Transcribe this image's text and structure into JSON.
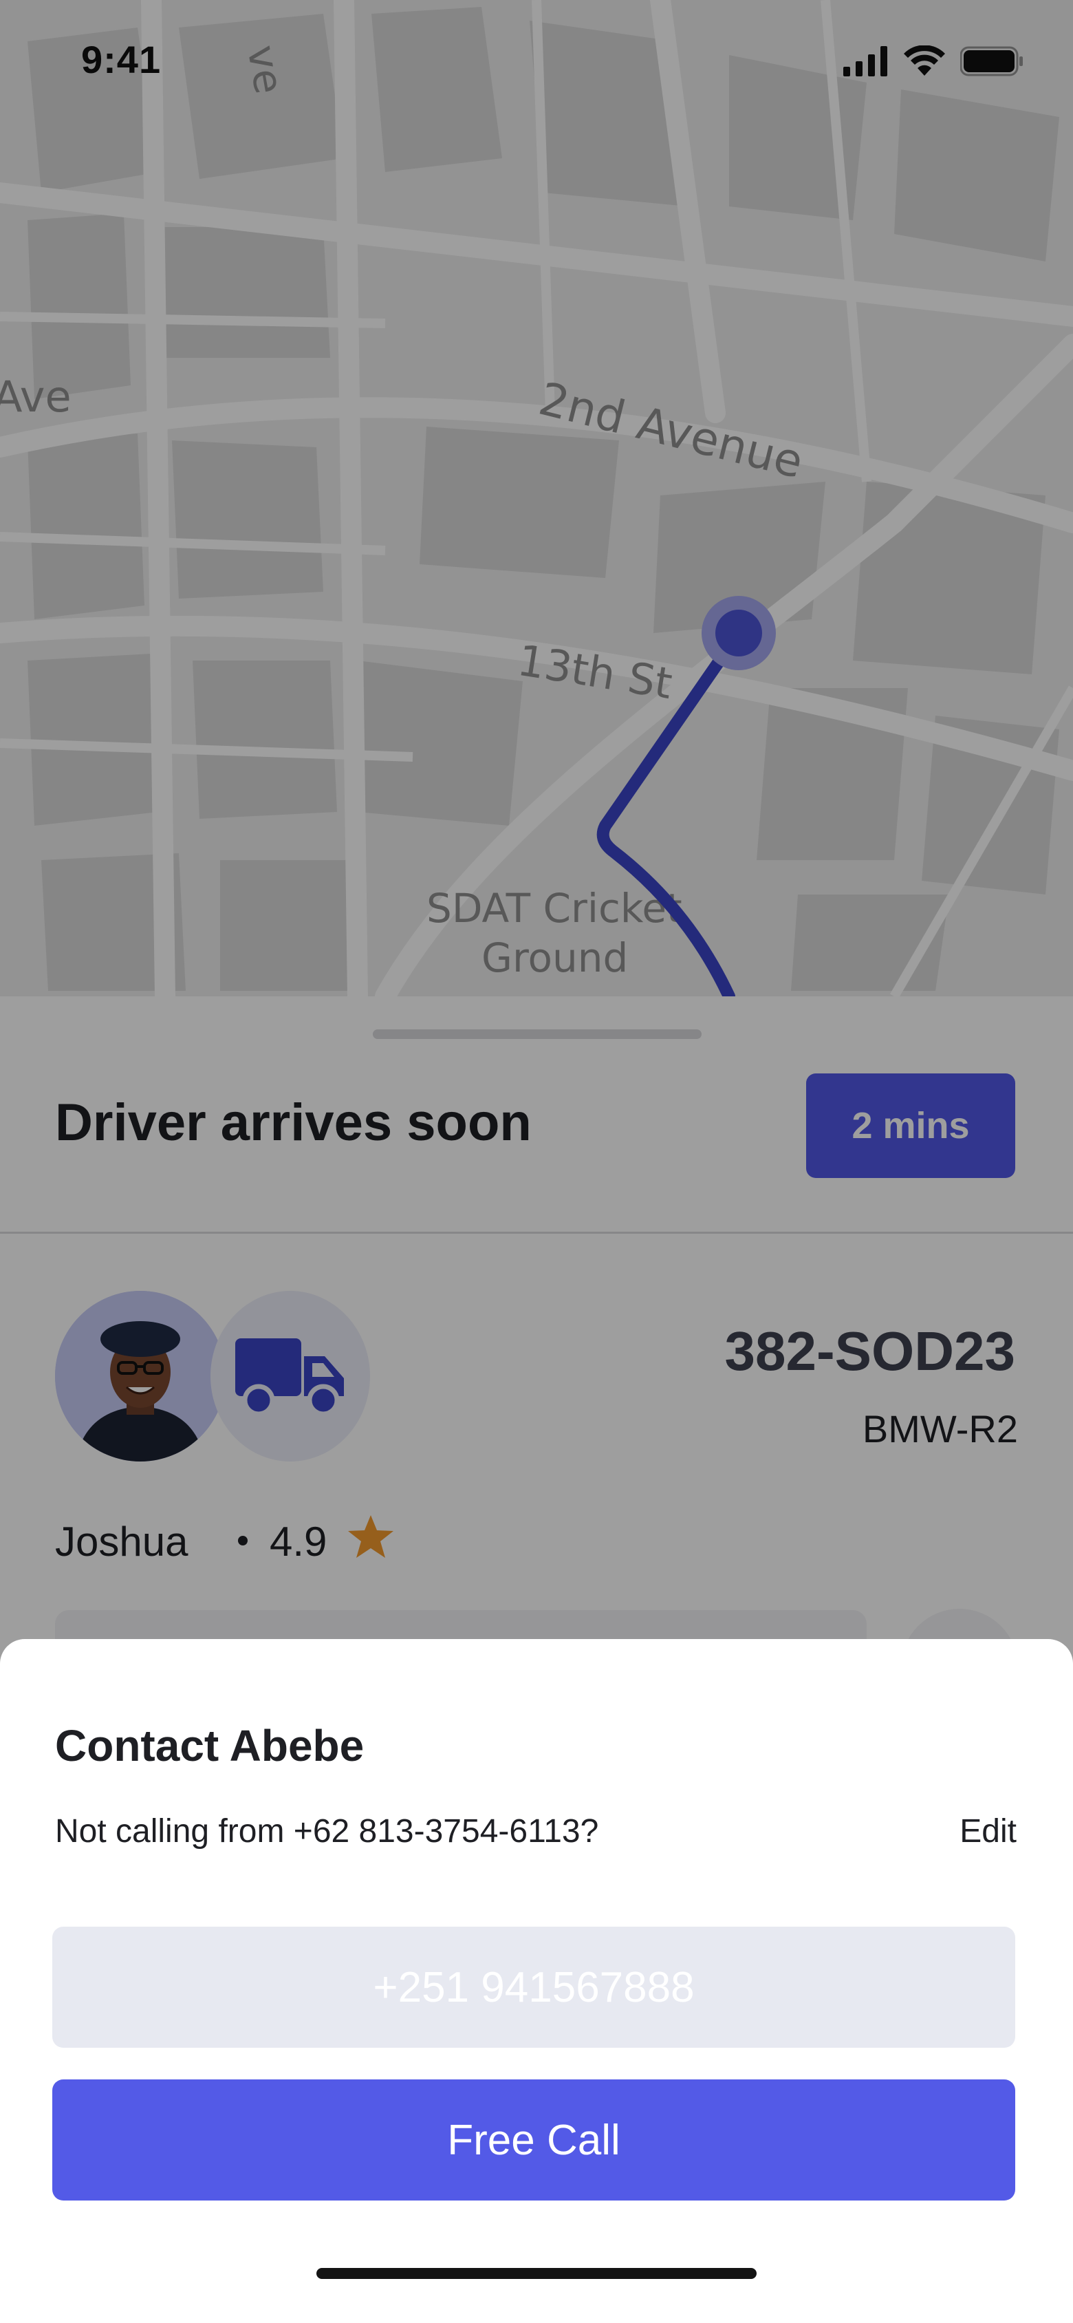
{
  "status_bar": {
    "time": "9:41",
    "icons": [
      "signal-icon",
      "wifi-icon",
      "battery-icon"
    ]
  },
  "map": {
    "street_labels": [
      "Ave",
      "2nd Avenue",
      "13th St",
      "SDAT Cricket",
      "Ground",
      "ve"
    ],
    "route_color": "#3b44c7",
    "marker_color": "#4d54d6"
  },
  "driver_panel": {
    "title": "Driver arrives soon",
    "eta": "2 mins",
    "plate": "382-SOD23",
    "car_model": "BMW-R2",
    "driver_name": "Joshua",
    "rating": "4.9",
    "vehicle_icon": "truck-icon"
  },
  "contact_sheet": {
    "title": "Contact Abebe",
    "calling_from": "Not calling from +62 813-3754-6113?",
    "edit_label": "Edit",
    "phone_number": "+251 941567888",
    "free_call_label": "Free Call"
  },
  "colors": {
    "accent": "#535ae7",
    "star": "#f29a2e",
    "overlay": "rgba(0,0,0,0.38)"
  }
}
